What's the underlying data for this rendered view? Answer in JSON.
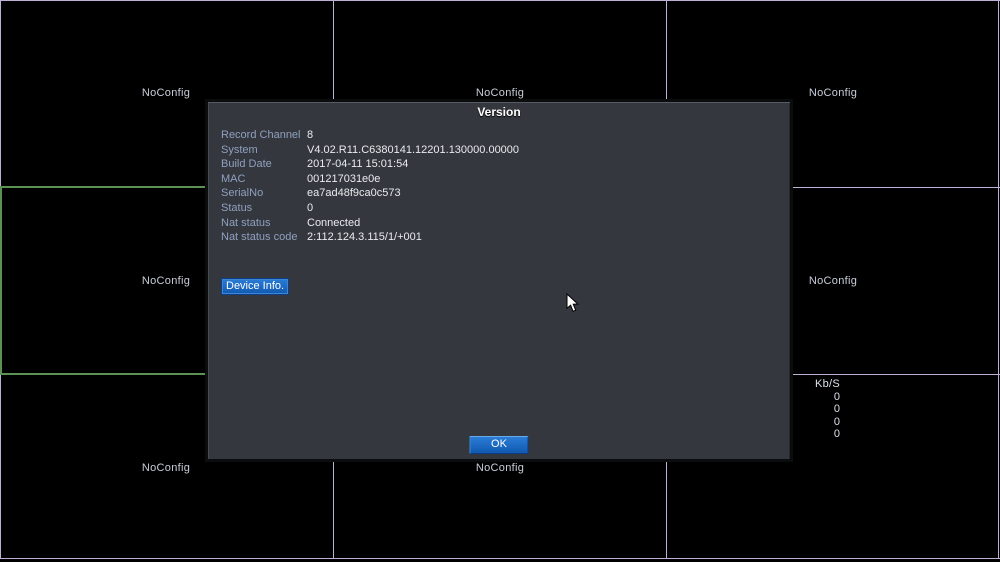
{
  "grid": {
    "no_config_label": "NoConfig",
    "selected_cell": "middle-left",
    "bitrate": {
      "header": "Kb/S",
      "values": [
        "0",
        "0",
        "0",
        "0"
      ]
    }
  },
  "dialog": {
    "title": "Version",
    "fields": [
      {
        "label": "Record Channel",
        "value": "8"
      },
      {
        "label": "System",
        "value": "V4.02.R11.C6380141.12201.130000.00000"
      },
      {
        "label": "Build Date",
        "value": "2017-04-11 15:01:54"
      },
      {
        "label": "MAC",
        "value": "001217031e0e"
      },
      {
        "label": "SerialNo",
        "value": "ea7ad48f9ca0c573"
      },
      {
        "label": "Status",
        "value": "0"
      },
      {
        "label": "Nat status",
        "value": "Connected"
      },
      {
        "label": "Nat status code",
        "value": "2:112.124.3.115/1/+001"
      }
    ],
    "device_info_button": "Device Info.",
    "ok_button": "OK"
  },
  "colors": {
    "grid_line": "#bfaed6",
    "selected_border": "#5c9254",
    "dialog_background": "#34373d",
    "field_label": "#8fa0c0",
    "accent_blue": "#1566c8",
    "video_background": "#000000"
  }
}
